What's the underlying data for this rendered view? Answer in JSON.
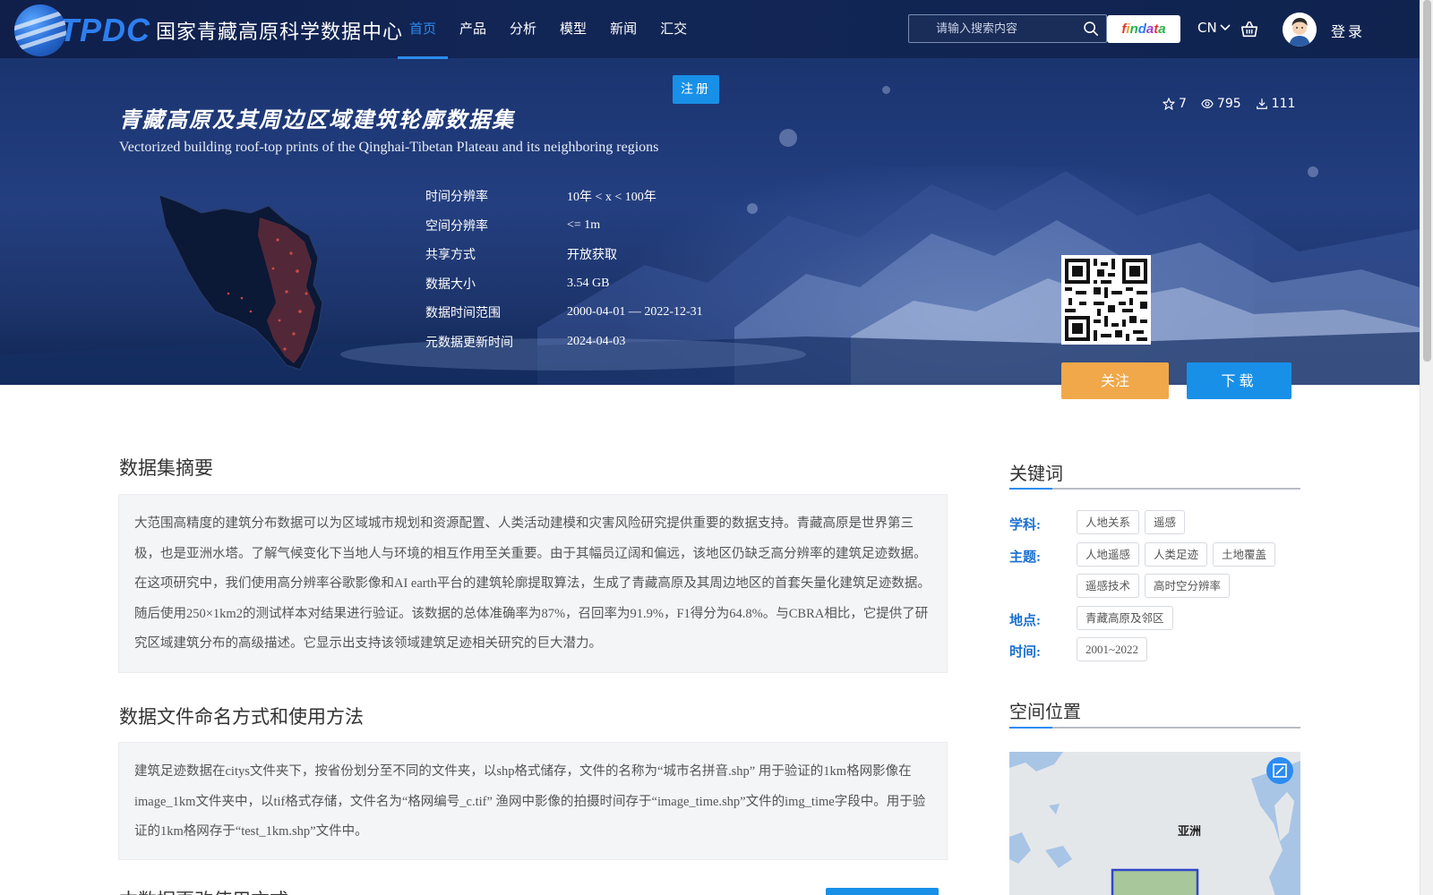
{
  "header": {
    "logo_text": "TPDC",
    "site_name": "国家青藏高原科学数据中心",
    "nav": [
      {
        "label": "首页",
        "active": true
      },
      {
        "label": "产品"
      },
      {
        "label": "分析"
      },
      {
        "label": "模型"
      },
      {
        "label": "新闻"
      },
      {
        "label": "汇交"
      }
    ],
    "search_placeholder": "请输入搜索内容",
    "findata_letters": [
      "f",
      "i",
      "n",
      "d",
      "a",
      "t",
      "a"
    ],
    "language": "CN",
    "login_label": "登录",
    "register_label": "注册"
  },
  "dataset": {
    "title_cn": "青藏高原及其周边区域建筑轮廓数据集",
    "title_en": "Vectorized building roof-top prints of the Qinghai-Tibetan Plateau and its neighboring regions",
    "stats": {
      "stars": "7",
      "views": "795",
      "downloads": "111"
    },
    "meta": [
      {
        "label": "时间分辨率",
        "value": "10年 < x < 100年"
      },
      {
        "label": "空间分辨率",
        "value": "<= 1m"
      },
      {
        "label": "共享方式",
        "value": "开放获取"
      },
      {
        "label": "数据大小",
        "value": "3.54 GB"
      },
      {
        "label": "数据时间范围",
        "value": "2000-04-01 — 2022-12-31"
      },
      {
        "label": "元数据更新时间",
        "value": "2024-04-03"
      }
    ],
    "follow_label": "关注",
    "download_label": "下载"
  },
  "sections": {
    "abstract_title": "数据集摘要",
    "abstract_text": "大范围高精度的建筑分布数据可以为区域城市规划和资源配置、人类活动建模和灾害风险研究提供重要的数据支持。青藏高原是世界第三极，也是亚洲水塔。了解气候变化下当地人与环境的相互作用至关重要。由于其幅员辽阔和偏远，该地区仍缺乏高分辨率的建筑足迹数据。在这项研究中，我们使用高分辨率谷歌影像和AI earth平台的建筑轮廓提取算法，生成了青藏高原及其周边地区的首套矢量化建筑足迹数据。随后使用250×1km2的测试样本对结果进行验证。该数据的总体准确率为87%，召回率为91.9%，F1得分为64.8%。与CBRA相比，它提供了研究区域建筑分布的高级描述。它显示出支持该领域建筑足迹相关研究的巨大潜力。",
    "naming_title": "数据文件命名方式和使用方法",
    "naming_text": "建筑足迹数据在citys文件夹下，按省份划分至不同的文件夹，以shp格式储存，文件的名称为“城市名拼音.shp” 用于验证的1km格网影像在image_1km文件夹中，以tif格式存储，文件名为“格网编号_c.tif” 渔网中影像的拍摄时间存于“image_time.shp”文件的img_time字段中。用于验证的1km格网存于“test_1km.shp”文件中。",
    "next_title": "本数据更改使用方式"
  },
  "sidebar": {
    "keywords_title": "关键词",
    "keyword_groups": [
      {
        "label": "学科:",
        "tags": [
          "人地关系",
          "遥感"
        ]
      },
      {
        "label": "主题:",
        "tags": [
          "人地遥感",
          "人类足迹",
          "土地覆盖",
          "遥感技术",
          "高时空分辨率"
        ]
      },
      {
        "label": "地点:",
        "tags": [
          "青藏高原及邻区"
        ]
      },
      {
        "label": "时间:",
        "tags": [
          "2001~2022"
        ]
      }
    ],
    "location_title": "空间位置",
    "map_label": "亚洲"
  },
  "colors": {
    "accent": "#2d8cf0",
    "follow": "#f0a84a",
    "header_bg": "#122656"
  }
}
